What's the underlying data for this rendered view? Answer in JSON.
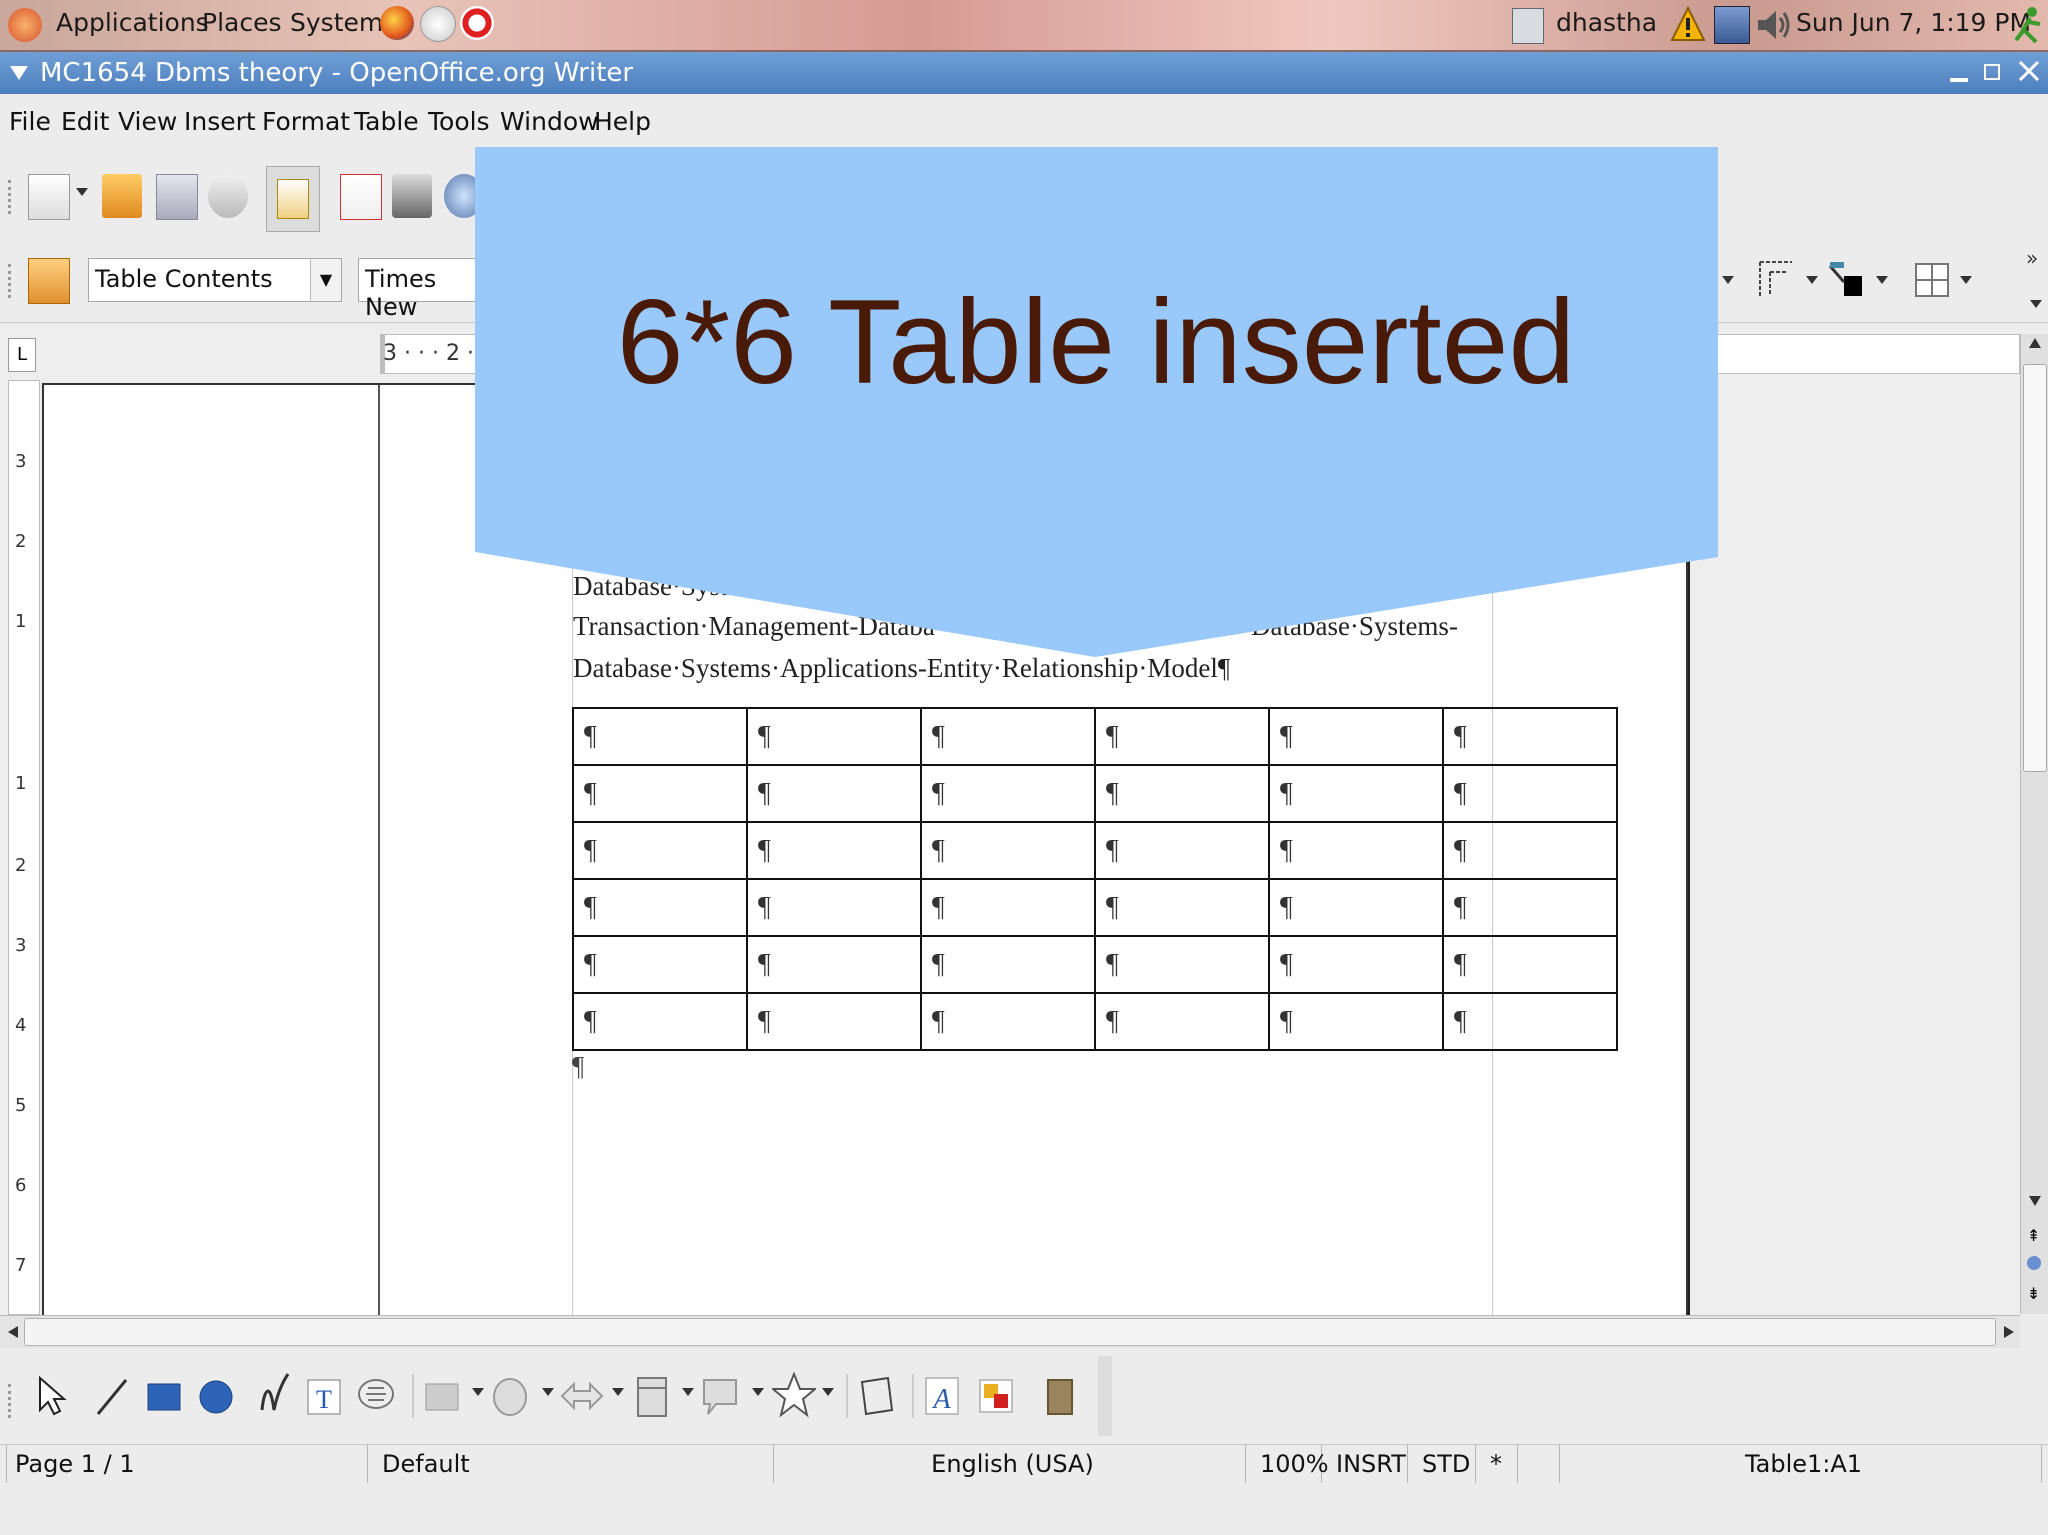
{
  "panel": {
    "menus": [
      "Applications",
      "Places",
      "System"
    ],
    "user": "dhastha",
    "clock": "Sun Jun  7,  1:19 PM"
  },
  "window": {
    "title": "MC1654 Dbms theory - OpenOffice.org Writer"
  },
  "menubar": {
    "items": [
      "File",
      "Edit",
      "View",
      "Insert",
      "Format",
      "Table",
      "Tools",
      "Window",
      "Help"
    ]
  },
  "format_toolbar": {
    "paragraph_style": "Table Contents",
    "font_name": "Times New"
  },
  "ruler": {
    "text": "3 · · · 2 ·",
    "vertical_marks": [
      "3",
      "2",
      "1",
      "1",
      "2",
      "3",
      "4",
      "5",
      "6",
      "7"
    ]
  },
  "document": {
    "lines": [
      "Database·Syste",
      "Transaction·Management-Databa",
      "·Database·Systems-",
      "Database·Systems·Applications-Entity·Relationship·Model¶"
    ],
    "pilcrow": "¶",
    "table_rows": [
      [
        "¶",
        "¶",
        "¶",
        "¶",
        "¶",
        "¶"
      ],
      [
        "¶",
        "¶",
        "¶",
        "¶",
        "¶",
        "¶"
      ],
      [
        "¶",
        "¶",
        "¶",
        "¶",
        "¶",
        "¶"
      ],
      [
        "¶",
        "¶",
        "¶",
        "¶",
        "¶",
        "¶"
      ],
      [
        "¶",
        "¶",
        "¶",
        "¶",
        "¶",
        "¶"
      ],
      [
        "¶",
        "¶",
        "¶",
        "¶",
        "¶",
        "¶"
      ]
    ]
  },
  "callout": {
    "text": "6*6 Table inserted",
    "fill": "#99c8fb",
    "text_color": "#4a1a08"
  },
  "statusbar": {
    "page": "Page 1 / 1",
    "page_style": "Default",
    "language": "English (USA)",
    "zoom": "100%",
    "insert_mode": "INSRT",
    "selection_mode": "STD",
    "modified": "*",
    "cell": "Table1:A1"
  }
}
